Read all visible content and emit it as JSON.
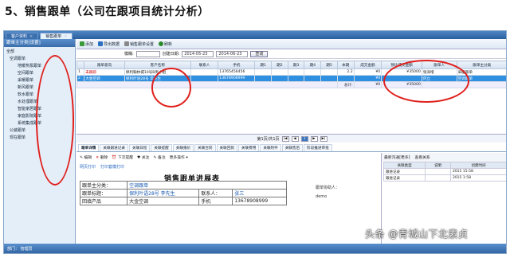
{
  "heading": "5、销售跟单（公司在跟项目统计分析）",
  "window": {
    "tabs": [
      {
        "label": "客户资料"
      },
      {
        "label": "销售跟单"
      }
    ]
  },
  "sidebar": {
    "title": "跟单主分类[设置]",
    "items": [
      {
        "label": "全部"
      },
      {
        "label": "空调跟单"
      },
      {
        "label": "地暖热泵跟单"
      },
      {
        "label": "空间跟单"
      },
      {
        "label": "采暖跟单"
      },
      {
        "label": "新风跟单"
      },
      {
        "label": "软水跟单"
      },
      {
        "label": "水处理跟单"
      },
      {
        "label": "智能家居跟单"
      },
      {
        "label": "家庭影院跟单"
      },
      {
        "label": "系统集成跟单"
      },
      {
        "label": "公装跟单"
      },
      {
        "label": "现在跟单"
      }
    ]
  },
  "toolbar": {
    "add": "添加",
    "export": "导出数据",
    "settings": "销售跟单设置",
    "refresh": "刷新"
  },
  "filter": {
    "label": "创建日期:",
    "from": "2014-05-23",
    "to": "2014-06-23",
    "query": "查询",
    "kw_label": "模糊:"
  },
  "grid": {
    "columns": [
      "跟单意向",
      "客户名称",
      "联系人",
      "手机",
      "期1",
      "期2",
      "期3",
      "期4",
      "期5",
      "本期",
      "成交金额",
      "预计成交金额",
      "跟单人",
      "跟单主分类"
    ],
    "rows": [
      [
        "未跟踪",
        "保利翰林城10号B男小姐",
        "",
        "13765456456",
        "",
        "",
        "",
        "",
        "",
        "2.2",
        "¥0",
        "¥35000",
        "张涛增",
        "采暖跟单"
      ],
      [
        "大金空调",
        "保利叶语28号 李先生",
        "",
        "13678908999",
        "",
        "",
        "",
        "",
        "",
        "",
        "¥0",
        "",
        "何立",
        "空调跟单"
      ]
    ],
    "summary_label": "总计:",
    "summary_deal": "¥0",
    "summary_expect": "¥35000"
  },
  "pager": {
    "info": "第1页/共1页",
    "page": "1"
  },
  "detail_tabs": [
    "跟单详情",
    "关联跟进记录",
    "关联日程",
    "关联提醒",
    "关联报价",
    "关联合同",
    "关联回款",
    "关联费用",
    "关联附件",
    "关联售后",
    "阶段推进审批"
  ],
  "detail_tools": {
    "edit": "编辑",
    "delete": "删除",
    "next": "下次提醒",
    "follow": "关注",
    "remark": "备注",
    "more": "更多操作"
  },
  "right_panel": {
    "title": "最新沟通[更多]",
    "view": "查看关系",
    "columns": [
      "关联类型",
      "说明",
      "创建时间"
    ],
    "rows": [
      [
        "跟进记录",
        "",
        "2015 15:58"
      ],
      [
        "跟进记录",
        "",
        "2015 1:58"
      ]
    ]
  },
  "print": {
    "print": "网页打印",
    "template": "打印套模打印"
  },
  "report": {
    "title": "销售跟单进展表",
    "rows": [
      [
        "跟单主分类：",
        "空调跟单",
        "",
        ""
      ],
      [
        "跟单标题：",
        "保利叶语28号 李先生",
        "联系人：",
        "张三"
      ],
      [
        "回填产品",
        "大金空调",
        "手机",
        "13678908999"
      ]
    ],
    "assist_label": "跟单协助人：",
    "assist_value": "demo"
  },
  "status_bar": "部门：  管理员",
  "watermark": "头条 @青城山下北素贞"
}
